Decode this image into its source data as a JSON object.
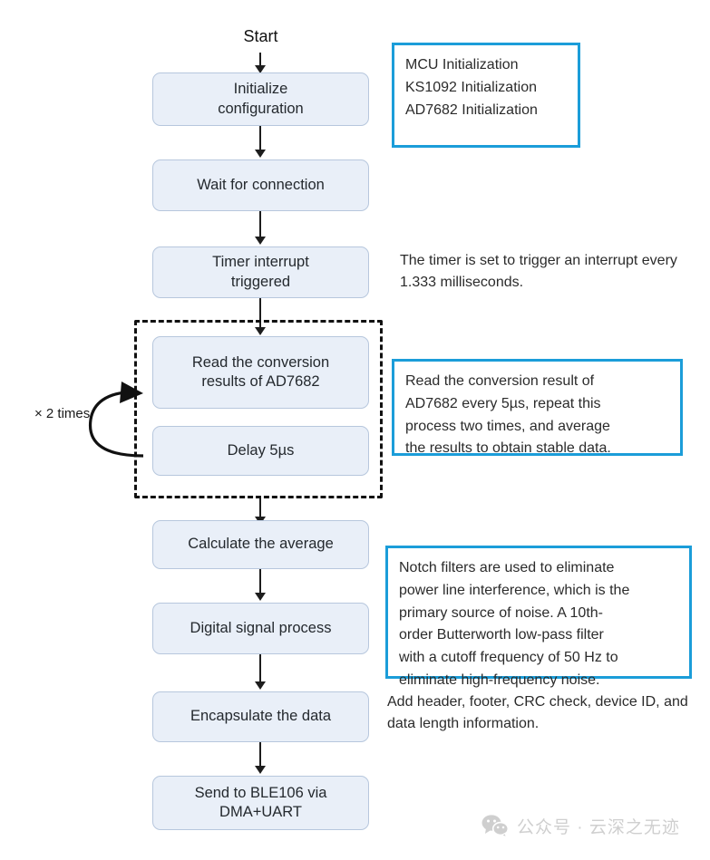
{
  "diagram": {
    "title": "Firmware acquisition flowchart",
    "start_label": "Start",
    "loop_label": "× 2 times",
    "accent_color": "#1b9dd9",
    "node_fill": "#e9eff8",
    "node_border": "#b7c7dd",
    "nodes": [
      {
        "id": "initialize",
        "label": "Initialize\nconfiguration"
      },
      {
        "id": "wait",
        "label": "Wait for connection"
      },
      {
        "id": "timer",
        "label": "Timer interrupt\ntriggered"
      },
      {
        "id": "read",
        "label": "Read the conversion\nresults of AD7682"
      },
      {
        "id": "delay",
        "label": "Delay 5µs"
      },
      {
        "id": "average",
        "label": "Calculate the average"
      },
      {
        "id": "dsp",
        "label": "Digital signal process"
      },
      {
        "id": "encapsulate",
        "label": "Encapsulate the data"
      },
      {
        "id": "send",
        "label": "Send to BLE106 via\nDMA+UART"
      }
    ],
    "notes": {
      "init": {
        "boxed": true,
        "lines": [
          "MCU Initialization",
          "KS1092 Initialization",
          "AD7682 Initialization"
        ]
      },
      "timer": {
        "boxed": false,
        "lines": [
          "The timer is set to trigger an",
          "interrupt every 1.333 milliseconds."
        ]
      },
      "read": {
        "boxed": true,
        "lines": [
          "Read the conversion result of",
          "AD7682 every 5µs, repeat this",
          "process two times, and average",
          "the results to obtain stable data."
        ]
      },
      "dsp": {
        "boxed": true,
        "lines": [
          "Notch filters are used to eliminate",
          "power line interference, which is the",
          "primary source of noise. A 10th-",
          "order Butterworth low-pass filter",
          "with a cutoff frequency of 50 Hz to",
          "eliminate high-frequency noise."
        ]
      },
      "encapsulate": {
        "boxed": false,
        "lines": [
          "Add header, footer, CRC check, device",
          "ID, and data length information."
        ]
      }
    },
    "watermark": {
      "icon": "wechat-icon",
      "text": "公众号 · 云深之无迹"
    }
  }
}
